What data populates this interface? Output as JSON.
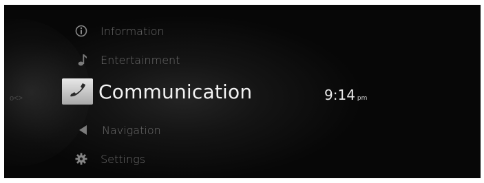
{
  "menu": {
    "items": [
      {
        "label": "Information",
        "icon": "info-icon",
        "selected": false
      },
      {
        "label": "Entertainment",
        "icon": "music-note-icon",
        "selected": false
      },
      {
        "label": "Communication",
        "icon": "phone-icon",
        "selected": true
      },
      {
        "label": "Navigation",
        "icon": "navigation-arrow-icon",
        "selected": false
      },
      {
        "label": "Settings",
        "icon": "gear-icon",
        "selected": false
      }
    ]
  },
  "clock": {
    "time": "9:14",
    "ampm": "pm"
  },
  "colors": {
    "background": "#0a0a0a",
    "selected_text": "#f2f2f2",
    "dim_text": "#6e6e6e"
  }
}
